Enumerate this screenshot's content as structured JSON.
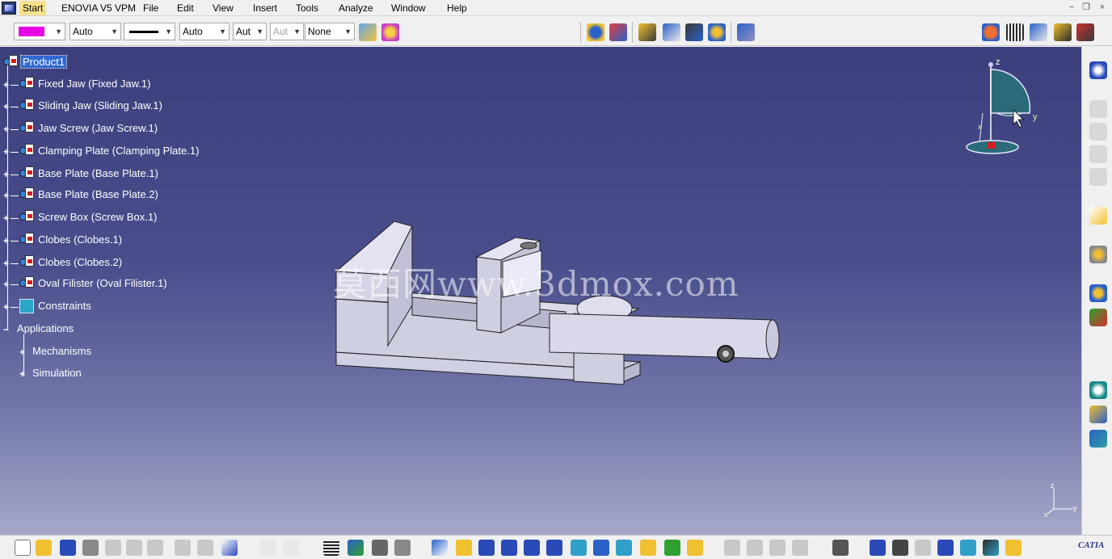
{
  "menu": {
    "start": "Start",
    "enovia": "ENOVIA V5 VPM",
    "file": "File",
    "edit": "Edit",
    "view": "View",
    "insert": "Insert",
    "tools": "Tools",
    "analyze": "Analyze",
    "window": "Window",
    "help": "Help",
    "win_minimize": "−",
    "win_restore": "❐",
    "win_close": "×"
  },
  "toolbar": {
    "color_value": "",
    "color_hex": "#e600e6",
    "transparency": "Auto",
    "line_width": "Auto",
    "line_type": "Aut",
    "point_type": "Aut",
    "layer": "None"
  },
  "tree": {
    "root": "Product1",
    "items": [
      "Fixed Jaw (Fixed Jaw.1)",
      "Sliding Jaw (Sliding Jaw.1)",
      "Jaw Screw (Jaw Screw.1)",
      "Clamping Plate (Clamping Plate.1)",
      "Base Plate (Base Plate.1)",
      "Base Plate (Base Plate.2)",
      "Screw Box (Screw Box.1)",
      "Clobes (Clobes.1)",
      "Clobes (Clobes.2)",
      "Oval Filister (Oval Filister.1)"
    ],
    "constraints": "Constraints",
    "applications": "Applications",
    "mechanisms": "Mechanisms",
    "simulation": "Simulation"
  },
  "compass": {
    "z": "z",
    "y": "y",
    "x": "x"
  },
  "watermark": "莫西网www.3dmox.com",
  "mini_axis": {
    "y": "y",
    "z": "z",
    "x": "x"
  },
  "catia_logo": "CATIA",
  "colors": {
    "viewport_top": "#3c3f7c",
    "viewport_bottom": "#a5a8c8",
    "selection": "#2f69d3",
    "start_highlight": "#f7e18c"
  }
}
